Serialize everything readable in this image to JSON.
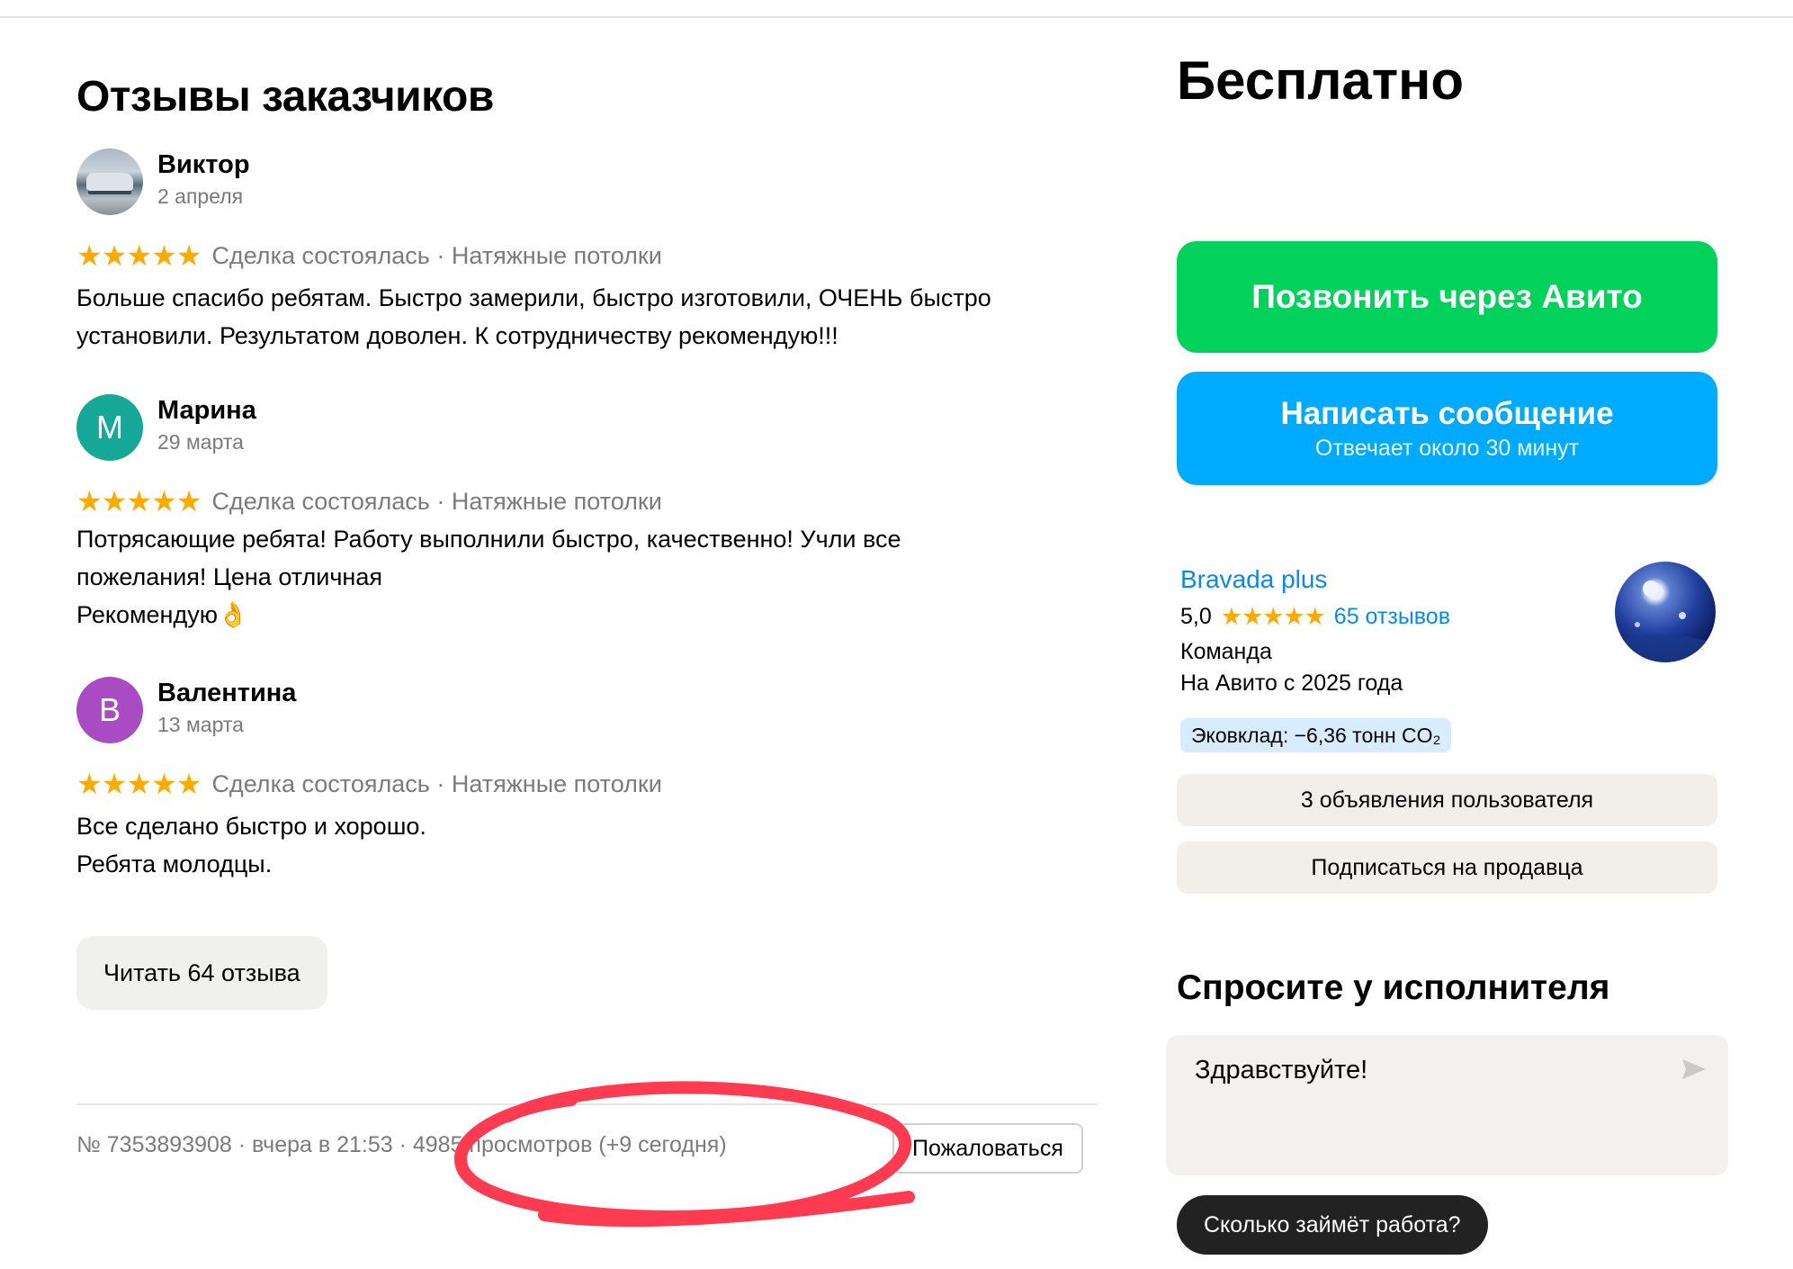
{
  "reviews_section": {
    "title": "Отзывы заказчиков",
    "reviews": [
      {
        "name": "Виктор",
        "date": "2 апреля",
        "avatar": "car-photo",
        "stars": "★★★★★",
        "meta": "Сделка состоялась · Натяжные потолки",
        "text": "Больше спасибо ребятам. Быстро замерили, быстро изготовили, ОЧЕНЬ быстро\nустановили. Результатом доволен. К сотрудничеству рекомендую!!!"
      },
      {
        "name": "Марина",
        "date": "29 марта",
        "avatar_letter": "М",
        "avatar_color": "#16a897",
        "stars": "★★★★★",
        "meta": "Сделка состоялась · Натяжные потолки",
        "text": "Потрясающие ребята! Работу выполнили быстро, качественно! Учли все\nпожелания! Цена отличная\nРекомендую👌"
      },
      {
        "name": "Валентина",
        "date": "13 марта",
        "avatar_letter": "В",
        "avatar_color": "#a94cc4",
        "stars": "★★★★★",
        "meta": "Сделка состоялась · Натяжные потолки",
        "text": "Все сделано быстро и хорошо.\nРебята молодцы."
      }
    ],
    "read_all_label": "Читать 64 отзыва"
  },
  "footer": {
    "info": "№ 7353893908 · вчера в 21:53 · 4985 просмотров (+9 сегодня)",
    "report_label": "Пожаловаться",
    "annotation_color": "#ff3b52"
  },
  "sidebar": {
    "price": "Бесплатно",
    "call_button": "Позвонить через Авито",
    "message_button": {
      "label": "Написать сообщение",
      "sublabel": "Отвечает около 30 минут"
    },
    "colors": {
      "call": "#02d15c",
      "message": "#00aaff",
      "link": "#0a8ae8"
    },
    "seller": {
      "name": "Bravada plus",
      "rating": "5,0",
      "stars": "★★★★★",
      "reviews_link": "65 отзывов",
      "type": "Команда",
      "since": "На Авито с 2025 года",
      "eco": "Эковклад: −6,36 тонн CO₂"
    },
    "listings_button": "3 объявления пользователя",
    "subscribe_button": "Подписаться на продавца"
  },
  "ask": {
    "title": "Спросите у исполнителя",
    "input_value": "Здравствуйте!",
    "chip_label": "Сколько займёт работа?"
  }
}
